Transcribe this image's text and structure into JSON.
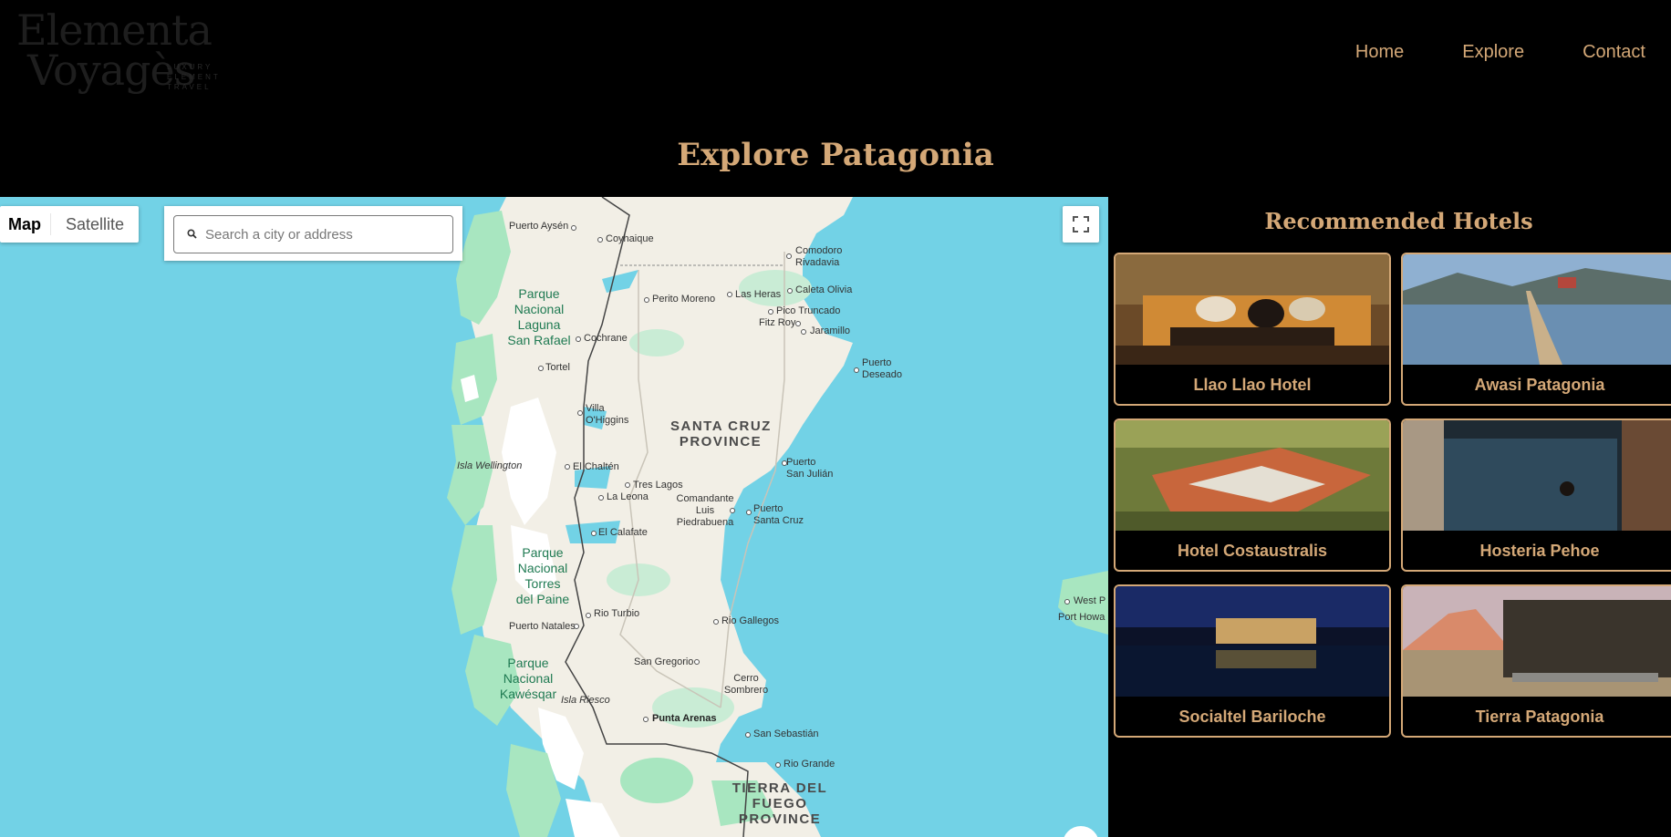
{
  "brand": {
    "line1": "Elementa",
    "line2": "Voyagès",
    "tagline": [
      "LUXURY",
      "ELEMENT",
      "TRAVEL"
    ]
  },
  "nav": [
    "Home",
    "Explore",
    "Contact"
  ],
  "page_title": "Explore Patagonia",
  "map": {
    "type_controls": [
      "Map",
      "Satellite"
    ],
    "active_type": "Map",
    "search_placeholder": "Search a city or address",
    "places": {
      "puerto_aysen": "Puerto Aysén",
      "coyhaique": "Coyhaique",
      "comodoro": "Comodoro",
      "rivadavia": "Rivadavia",
      "perito_moreno": "Perito Moreno",
      "las_heras": "Las Heras",
      "caleta_olivia": "Caleta Olivia",
      "pico_truncado": "Pico Truncado",
      "fitz_roy": "Fitz Roy",
      "jaramillo": "Jaramillo",
      "puerto_deseado_1": "Puerto",
      "puerto_deseado_2": "Deseado",
      "cochrane": "Cochrane",
      "tortel": "Tortel",
      "villa_ohiggins_1": "Villa",
      "villa_ohiggins_2": "O'Higgins",
      "isla_wellington": "Isla Wellington",
      "el_chalten": "El Chaltén",
      "tres_lagos": "Tres Lagos",
      "la_leona": "La Leona",
      "comandante_1": "Comandante",
      "comandante_2": "Luis",
      "comandante_3": "Piedrabuena",
      "puerto_sj_1": "Puerto",
      "puerto_sj_2": "San Julián",
      "puerto_sc_1": "Puerto",
      "puerto_sc_2": "Santa Cruz",
      "el_calafate": "El Calafate",
      "rio_turbio": "Rio Turbio",
      "rio_gallegos": "Rio Gallegos",
      "puerto_natales": "Puerto Natales",
      "san_gregorio": "San Gregorio",
      "cerro_sombrero_1": "Cerro",
      "cerro_sombrero_2": "Sombrero",
      "isla_riesco": "Isla Riesco",
      "punta_arenas": "Punta Arenas",
      "san_sebastian": "San Sebastián",
      "rio_grande": "Rio Grande",
      "west_point": "West P",
      "port_howard": "Port Howa"
    },
    "parks": {
      "laguna_san_rafael": [
        "Parque",
        "Nacional",
        "Laguna",
        "San Rafael"
      ],
      "torres_del_paine": [
        "Parque",
        "Nacional",
        "Torres",
        "del Paine"
      ],
      "kawesqar": [
        "Parque",
        "Nacional",
        "Kawésqar"
      ]
    },
    "regions": {
      "santa_cruz": [
        "SANTA CRUZ",
        "PROVINCE"
      ],
      "tierra_del_fuego": [
        "TIERRA DEL",
        "FUEGO",
        "PROVINCE"
      ]
    }
  },
  "hotels": {
    "title": "Recommended Hotels",
    "items": [
      {
        "name": "Llao Llao Hotel",
        "image": "lounge-interior-photo"
      },
      {
        "name": "Awasi Patagonia",
        "image": "wooden-pier-lake-photo"
      },
      {
        "name": "Hotel Costaustralis",
        "image": "aerial-hotel-town-photo"
      },
      {
        "name": "Hosteria Pehoe",
        "image": "indoor-pool-photo"
      },
      {
        "name": "Socialtel Bariloche",
        "image": "night-waterfront-photo"
      },
      {
        "name": "Tierra Patagonia",
        "image": "cabin-volcano-photo"
      }
    ]
  },
  "colors": {
    "accent": "#d4a877",
    "background": "#000000",
    "water": "#72d2e6",
    "land": "#f2efe6",
    "park_green": "#a8e6c0"
  }
}
